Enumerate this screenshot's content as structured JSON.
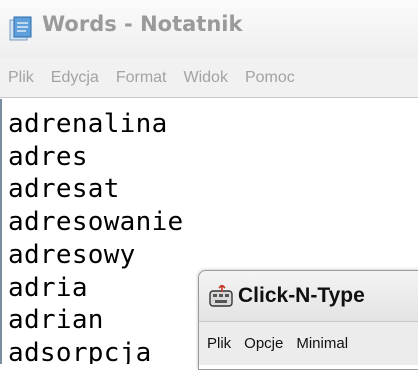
{
  "notepad": {
    "title": "Words - Notatnik",
    "icon": "notepad-icon",
    "menu": [
      "Plik",
      "Edycja",
      "Format",
      "Widok",
      "Pomoc"
    ],
    "lines": [
      "adrenalina",
      "adres",
      "adresat",
      "adresowanie",
      "adresowy",
      "adria",
      "adrian",
      "adsorpcja"
    ]
  },
  "clickntype": {
    "title": "Click-N-Type",
    "icon": "clickntype-icon",
    "menu": [
      "Plik",
      "Opcje",
      "Minimal"
    ]
  }
}
